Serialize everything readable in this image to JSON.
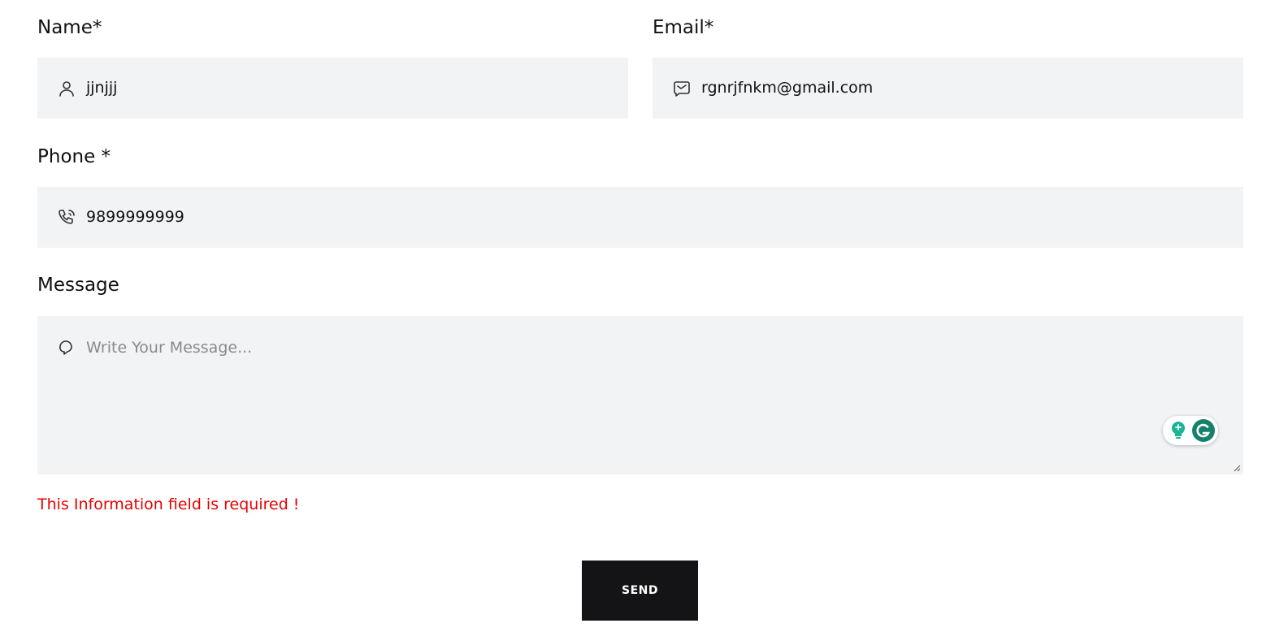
{
  "form": {
    "name": {
      "label": "Name*",
      "value": "jjnjjj",
      "icon": "user-icon"
    },
    "email": {
      "label": "Email*",
      "value": "rgnrjfnkm@gmail.com",
      "icon": "email-icon"
    },
    "phone": {
      "label": "Phone *",
      "value": "9899999999",
      "icon": "phone-icon"
    },
    "message": {
      "label": "Message",
      "placeholder": "Write Your Message...",
      "value": "",
      "icon": "chat-icon"
    },
    "error_text": "This Information field is required !",
    "send_label": "SEND"
  },
  "colors": {
    "field_bg": "#f2f3f5",
    "error": "#e60000",
    "button_bg": "#141416",
    "button_text": "#ffffff",
    "grammarly": "#15816b"
  }
}
